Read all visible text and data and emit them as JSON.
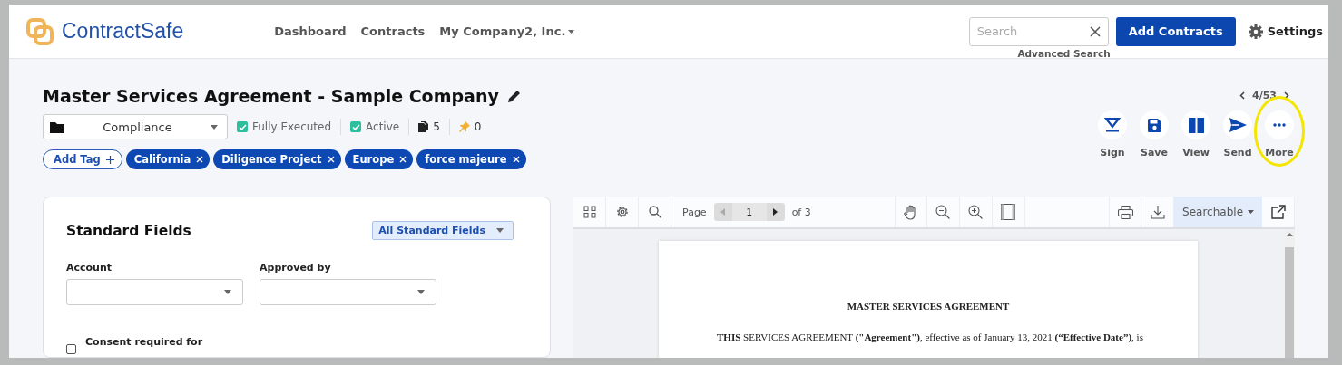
{
  "header": {
    "logo_text": "ContractSafe",
    "nav": [
      {
        "label": "Dashboard",
        "kind": "link"
      },
      {
        "label": "Contracts",
        "kind": "link"
      },
      {
        "label": "My Company2, Inc.",
        "kind": "menu"
      }
    ],
    "search": {
      "placeholder": "Search"
    },
    "advanced_search": "Advanced Search",
    "add_button": "Add Contracts",
    "settings": "Settings"
  },
  "contract": {
    "title": "Master Services Agreement - Sample Company",
    "pager": "4/53",
    "folder": "Compliance",
    "statuses": [
      {
        "label": "Fully Executed",
        "checked": true
      },
      {
        "label": "Active",
        "checked": true
      }
    ],
    "documents_count": "5",
    "pins_count": "0",
    "add_tag": "Add Tag",
    "tags": [
      {
        "label": "California"
      },
      {
        "label": "Diligence Project"
      },
      {
        "label": "Europe"
      },
      {
        "label": "force majeure"
      }
    ],
    "actions": [
      {
        "label": "Sign",
        "kind": "sign",
        "annotated": false
      },
      {
        "label": "Save",
        "kind": "save",
        "annotated": false
      },
      {
        "label": "View",
        "kind": "view",
        "annotated": false
      },
      {
        "label": "Send",
        "kind": "send",
        "annotated": false
      },
      {
        "label": "More",
        "kind": "more",
        "annotated": true
      }
    ]
  },
  "standard_fields": {
    "title": "Standard Fields",
    "filter": "All Standard Fields",
    "fields": [
      {
        "label": "Account"
      },
      {
        "label": "Approved by"
      }
    ],
    "checkboxes": [
      {
        "label": "Consent required for",
        "checked": false
      }
    ]
  },
  "viewer": {
    "page_label": "Page",
    "page": "1",
    "page_total": "of 3",
    "mode": "Searchable",
    "document": {
      "heading": "MASTER SERVICES AGREEMENT",
      "paragraph": "**THIS** SERVICES AGREEMENT **(\"Agreement\")**, effective as of January 13, 2021 **(“Effective Date”)**, is"
    }
  }
}
